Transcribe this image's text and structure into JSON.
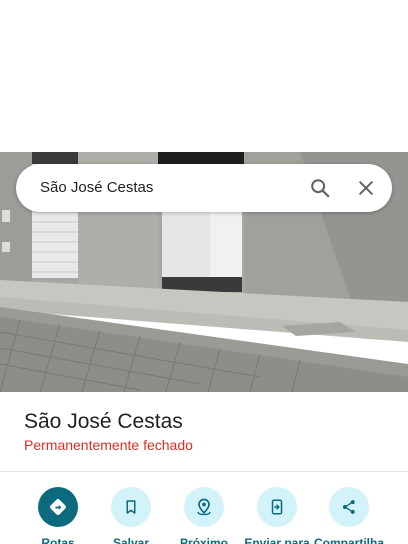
{
  "search": {
    "query": "São José Cestas"
  },
  "place": {
    "name": "São José Cestas",
    "status": "Permanentemente fechado"
  },
  "actions": [
    {
      "label": "Rotas",
      "icon": "directions-icon"
    },
    {
      "label": "Salvar",
      "icon": "bookmark-icon"
    },
    {
      "label": "Próximo",
      "icon": "nearby-icon"
    },
    {
      "label": "Enviar para",
      "icon": "send-to-phone-icon"
    },
    {
      "label": "Compartilha",
      "icon": "share-icon"
    }
  ],
  "colors": {
    "accent": "#0b6a7e",
    "action_bg": "#d3f3fb",
    "closed_status": "#d93025"
  }
}
